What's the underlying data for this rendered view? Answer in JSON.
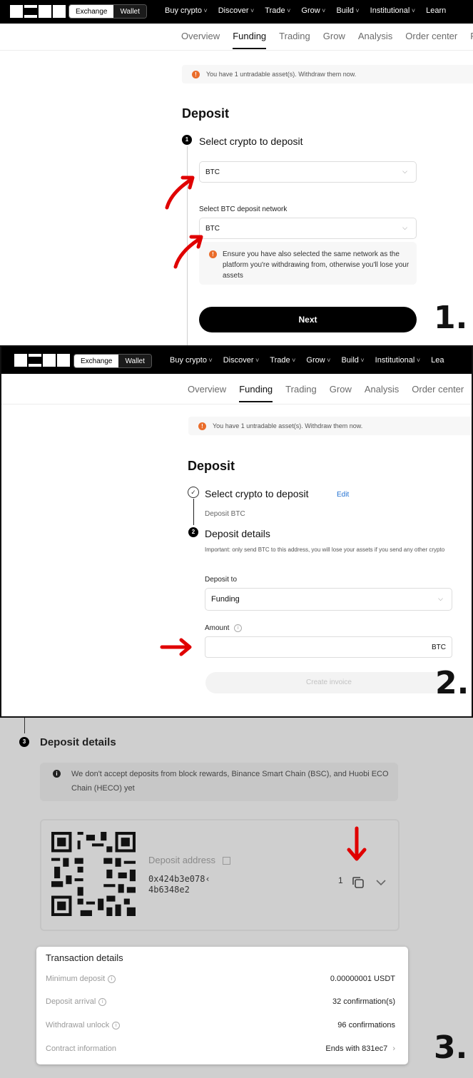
{
  "nav": {
    "segment": {
      "exchange": "Exchange",
      "wallet": "Wallet"
    },
    "menu": [
      "Buy crypto",
      "Discover",
      "Trade",
      "Grow",
      "Build",
      "Institutional",
      "Learn"
    ],
    "menu2_last": "Lea"
  },
  "subnav": {
    "tabs": [
      "Overview",
      "Funding",
      "Trading",
      "Grow",
      "Analysis",
      "Order center"
    ],
    "overflow": "Fe"
  },
  "alert_text": "You have 1 untradable asset(s). Withdraw them now.",
  "deposit_title": "Deposit",
  "panel1": {
    "step1_num": "1",
    "step1_title": "Select crypto to deposit",
    "crypto_value": "BTC",
    "network_label": "Select BTC deposit network",
    "network_value": "BTC",
    "network_note": "Ensure you have also selected the same network as the platform you're withdrawing from, otherwise you'll lose your assets",
    "next_label": "Next",
    "marker": "1."
  },
  "panel2": {
    "step1_title": "Select crypto to deposit",
    "edit_label": "Edit",
    "step1_summary": "Deposit BTC",
    "step2_num": "2",
    "step2_title": "Deposit details",
    "important": "Important: only send BTC to this address, you will lose your assets if you send any other crypto",
    "deposit_to_label": "Deposit to",
    "deposit_to_value": "Funding",
    "amount_label": "Amount",
    "amount_unit": "BTC",
    "create_invoice": "Create invoice",
    "marker": "2."
  },
  "panel3": {
    "step_num": "3",
    "title": "Deposit details",
    "note": "We don't accept deposits from block rewards, Binance Smart Chain (BSC), and Huobi ECO Chain (HECO) yet",
    "address_label": "Deposit address",
    "address_line1": "0x424b3e078‹",
    "address_line2": "4b6348e2",
    "address_suffix": "1",
    "tx_title": "Transaction details",
    "tx_rows": [
      {
        "key": "Minimum deposit",
        "value": "0.00000001 USDT"
      },
      {
        "key": "Deposit arrival",
        "value": "32 confirmation(s)"
      },
      {
        "key": "Withdrawal unlock",
        "value": "96 confirmations"
      },
      {
        "key": "Contract information",
        "value": "Ends with 831ec7"
      }
    ],
    "marker": "3."
  },
  "colors": {
    "accent_warn": "#ea6d2b",
    "annotation_red": "#e00000",
    "link": "#1f6fd1"
  }
}
